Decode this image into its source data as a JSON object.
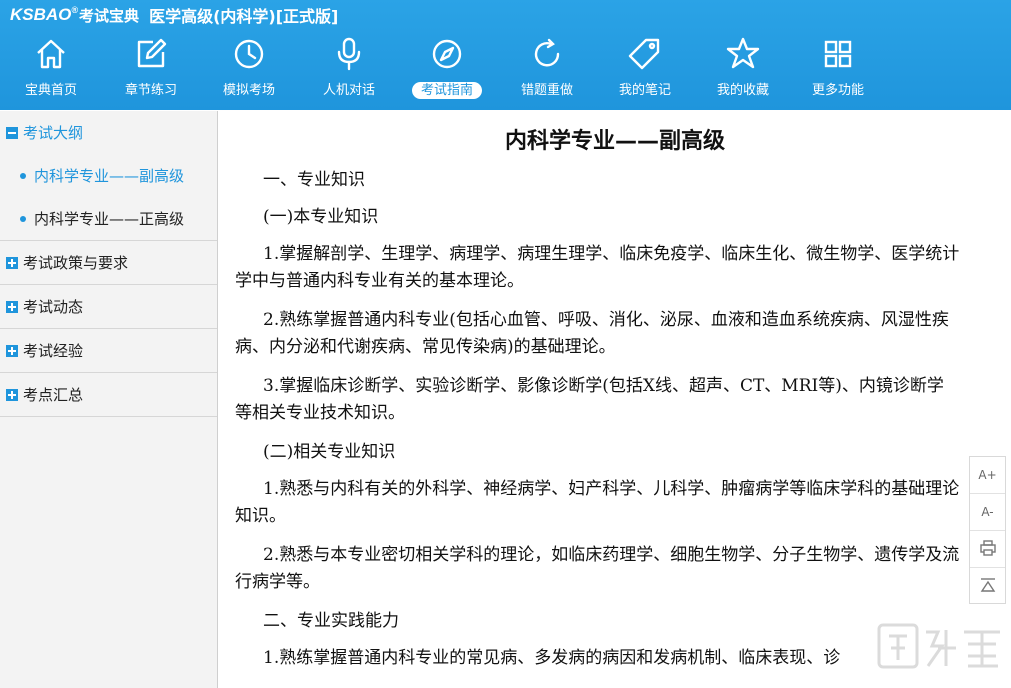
{
  "header": {
    "logo": "KSBAO",
    "logo_sup": "®",
    "brand": "考试宝典",
    "title": "医学高级(内科学)[正式版]"
  },
  "nav": [
    {
      "label": "宝典首页",
      "icon": "home-icon"
    },
    {
      "label": "章节练习",
      "icon": "edit-icon"
    },
    {
      "label": "模拟考场",
      "icon": "clock-icon"
    },
    {
      "label": "人机对话",
      "icon": "microphone-icon"
    },
    {
      "label": "考试指南",
      "icon": "compass-icon",
      "active": true
    },
    {
      "label": "错题重做",
      "icon": "refresh-icon"
    },
    {
      "label": "我的笔记",
      "icon": "tag-icon"
    },
    {
      "label": "我的收藏",
      "icon": "star-icon"
    },
    {
      "label": "更多功能",
      "icon": "grid-icon"
    }
  ],
  "sidebar": {
    "outline": {
      "label": "考试大纲",
      "items": [
        {
          "label": "内科学专业——副高级",
          "active": true
        },
        {
          "label": "内科学专业——正高级"
        }
      ]
    },
    "groups": [
      {
        "label": "考试政策与要求"
      },
      {
        "label": "考试动态"
      },
      {
        "label": "考试经验"
      },
      {
        "label": "考点汇总"
      }
    ]
  },
  "document": {
    "title": "内科学专业——副高级",
    "paragraphs": [
      "一、专业知识",
      "(一)本专业知识",
      "1.掌握解剖学、生理学、病理学、病理生理学、临床免疫学、临床生化、微生物学、医学统计学中与普通内科专业有关的基本理论。",
      "2.熟练掌握普通内科专业(包括心血管、呼吸、消化、泌尿、血液和造血系统疾病、风湿性疾病、内分泌和代谢疾病、常见传染病)的基础理论。",
      "3.掌握临床诊断学、实验诊断学、影像诊断学(包括X线、超声、CT、MRI等)、内镜诊断学等相关专业技术知识。",
      "(二)相关专业知识",
      "1.熟悉与内科有关的外科学、神经病学、妇产科学、儿科学、肿瘤病学等临床学科的基础理论知识。",
      "2.熟悉与本专业密切相关学科的理论，如临床药理学、细胞生物学、分子生物学、遗传学及流行病学等。",
      "二、专业实践能力",
      "1.熟练掌握普通内科专业的常见病、多发病的病因和发病机制、临床表现、诊"
    ]
  },
  "tools": {
    "font_up": "A+",
    "font_down": "A-"
  },
  "colors": {
    "accent": "#1f95dc",
    "header": "#2ba3e6",
    "sidebar_bg": "#f3f3f3"
  }
}
